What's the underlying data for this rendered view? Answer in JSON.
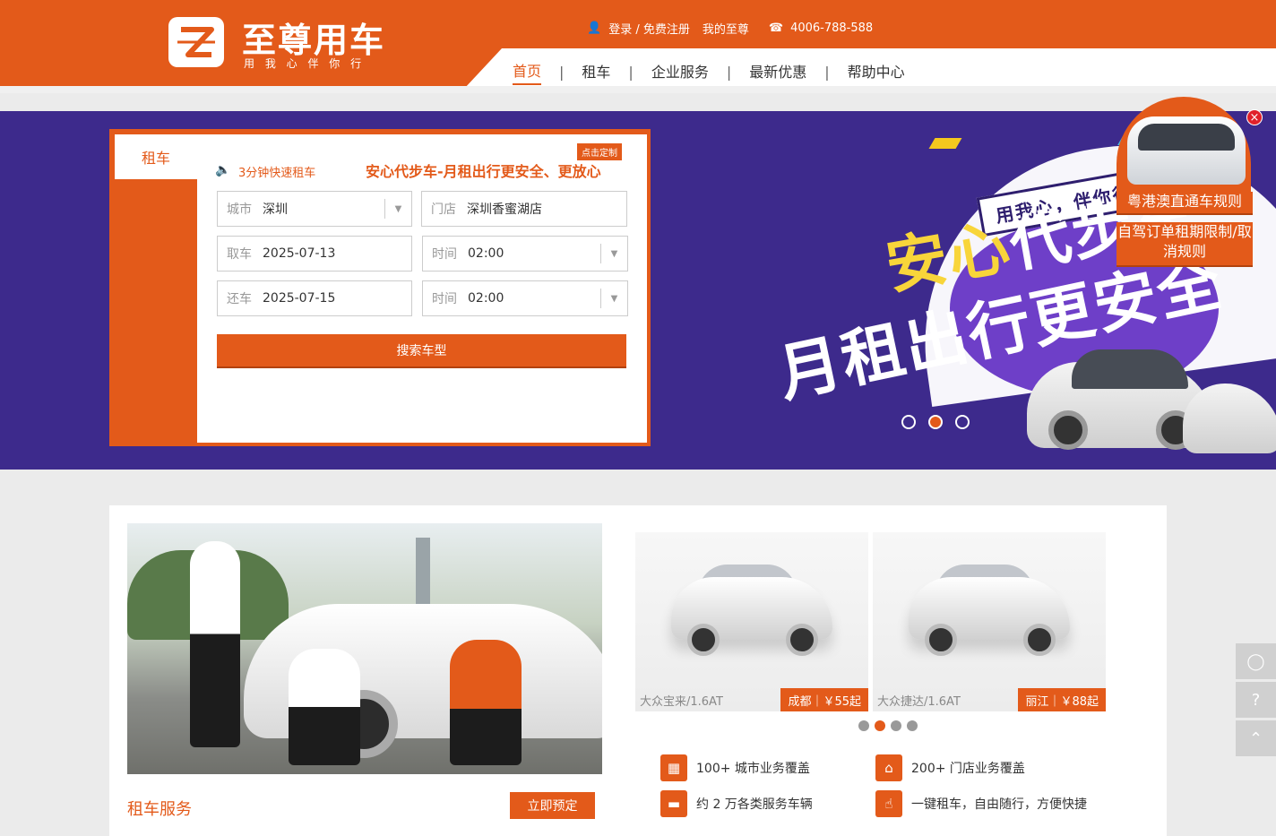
{
  "header": {
    "brand_name": "至尊用车",
    "brand_slogan": "用 我 心    伴 你 行",
    "login_label": "登录 / 免费注册",
    "account_label": "我的至尊",
    "hotline": "4006-788-588",
    "nav": [
      {
        "label": "首页",
        "active": true
      },
      {
        "label": "租车"
      },
      {
        "label": "企业服务"
      },
      {
        "label": "最新优惠"
      },
      {
        "label": "帮助中心"
      }
    ]
  },
  "booking": {
    "tab_label": "租车",
    "quick_label": "3分钟快速租车",
    "slogan": "安心代步车-月租出行更安全、更放心",
    "badge": "点击定制",
    "city_label": "城市",
    "city_value": "深圳",
    "store_label": "门店",
    "store_value": "深圳香蜜湖店",
    "pickup_label": "取车",
    "pickup_date": "2025-07-13",
    "pickup_time_label": "时间",
    "pickup_time": "02:00",
    "return_label": "还车",
    "return_date": "2025-07-15",
    "return_time_label": "时间",
    "return_time": "02:00",
    "search_button": "搜索车型"
  },
  "banner": {
    "tagline": "用我心，伴你行",
    "headline_1_yellow": "安心",
    "headline_1_white": "代步车",
    "headline_2": "月租出行更安全",
    "slide_count": 3,
    "active_slide": 2
  },
  "promo": {
    "link_1": "粤港澳直通车规则",
    "link_2": "自驾订单租期限制/取消规则",
    "close": "×"
  },
  "service": {
    "title": "租车服务",
    "book_button": "立即预定"
  },
  "cars": [
    {
      "name": "大众宝来/1.6AT",
      "price": "成都｜￥55起"
    },
    {
      "name": "大众捷达/1.6AT",
      "price": "丽江｜￥88起"
    }
  ],
  "carousel": {
    "count": 4,
    "active": 2
  },
  "features": [
    {
      "icon": "building-icon",
      "text": "100+ 城市业务覆盖"
    },
    {
      "icon": "store-icon",
      "text": "200+ 门店业务覆盖"
    },
    {
      "icon": "car-icon",
      "text": "约 2 万各类服务车辆"
    },
    {
      "icon": "tap-icon",
      "text": "一键租车，自由随行，方便快捷"
    }
  ],
  "colors": {
    "brand_orange": "#e35a1a",
    "banner_purple": "#3d2a8c"
  }
}
